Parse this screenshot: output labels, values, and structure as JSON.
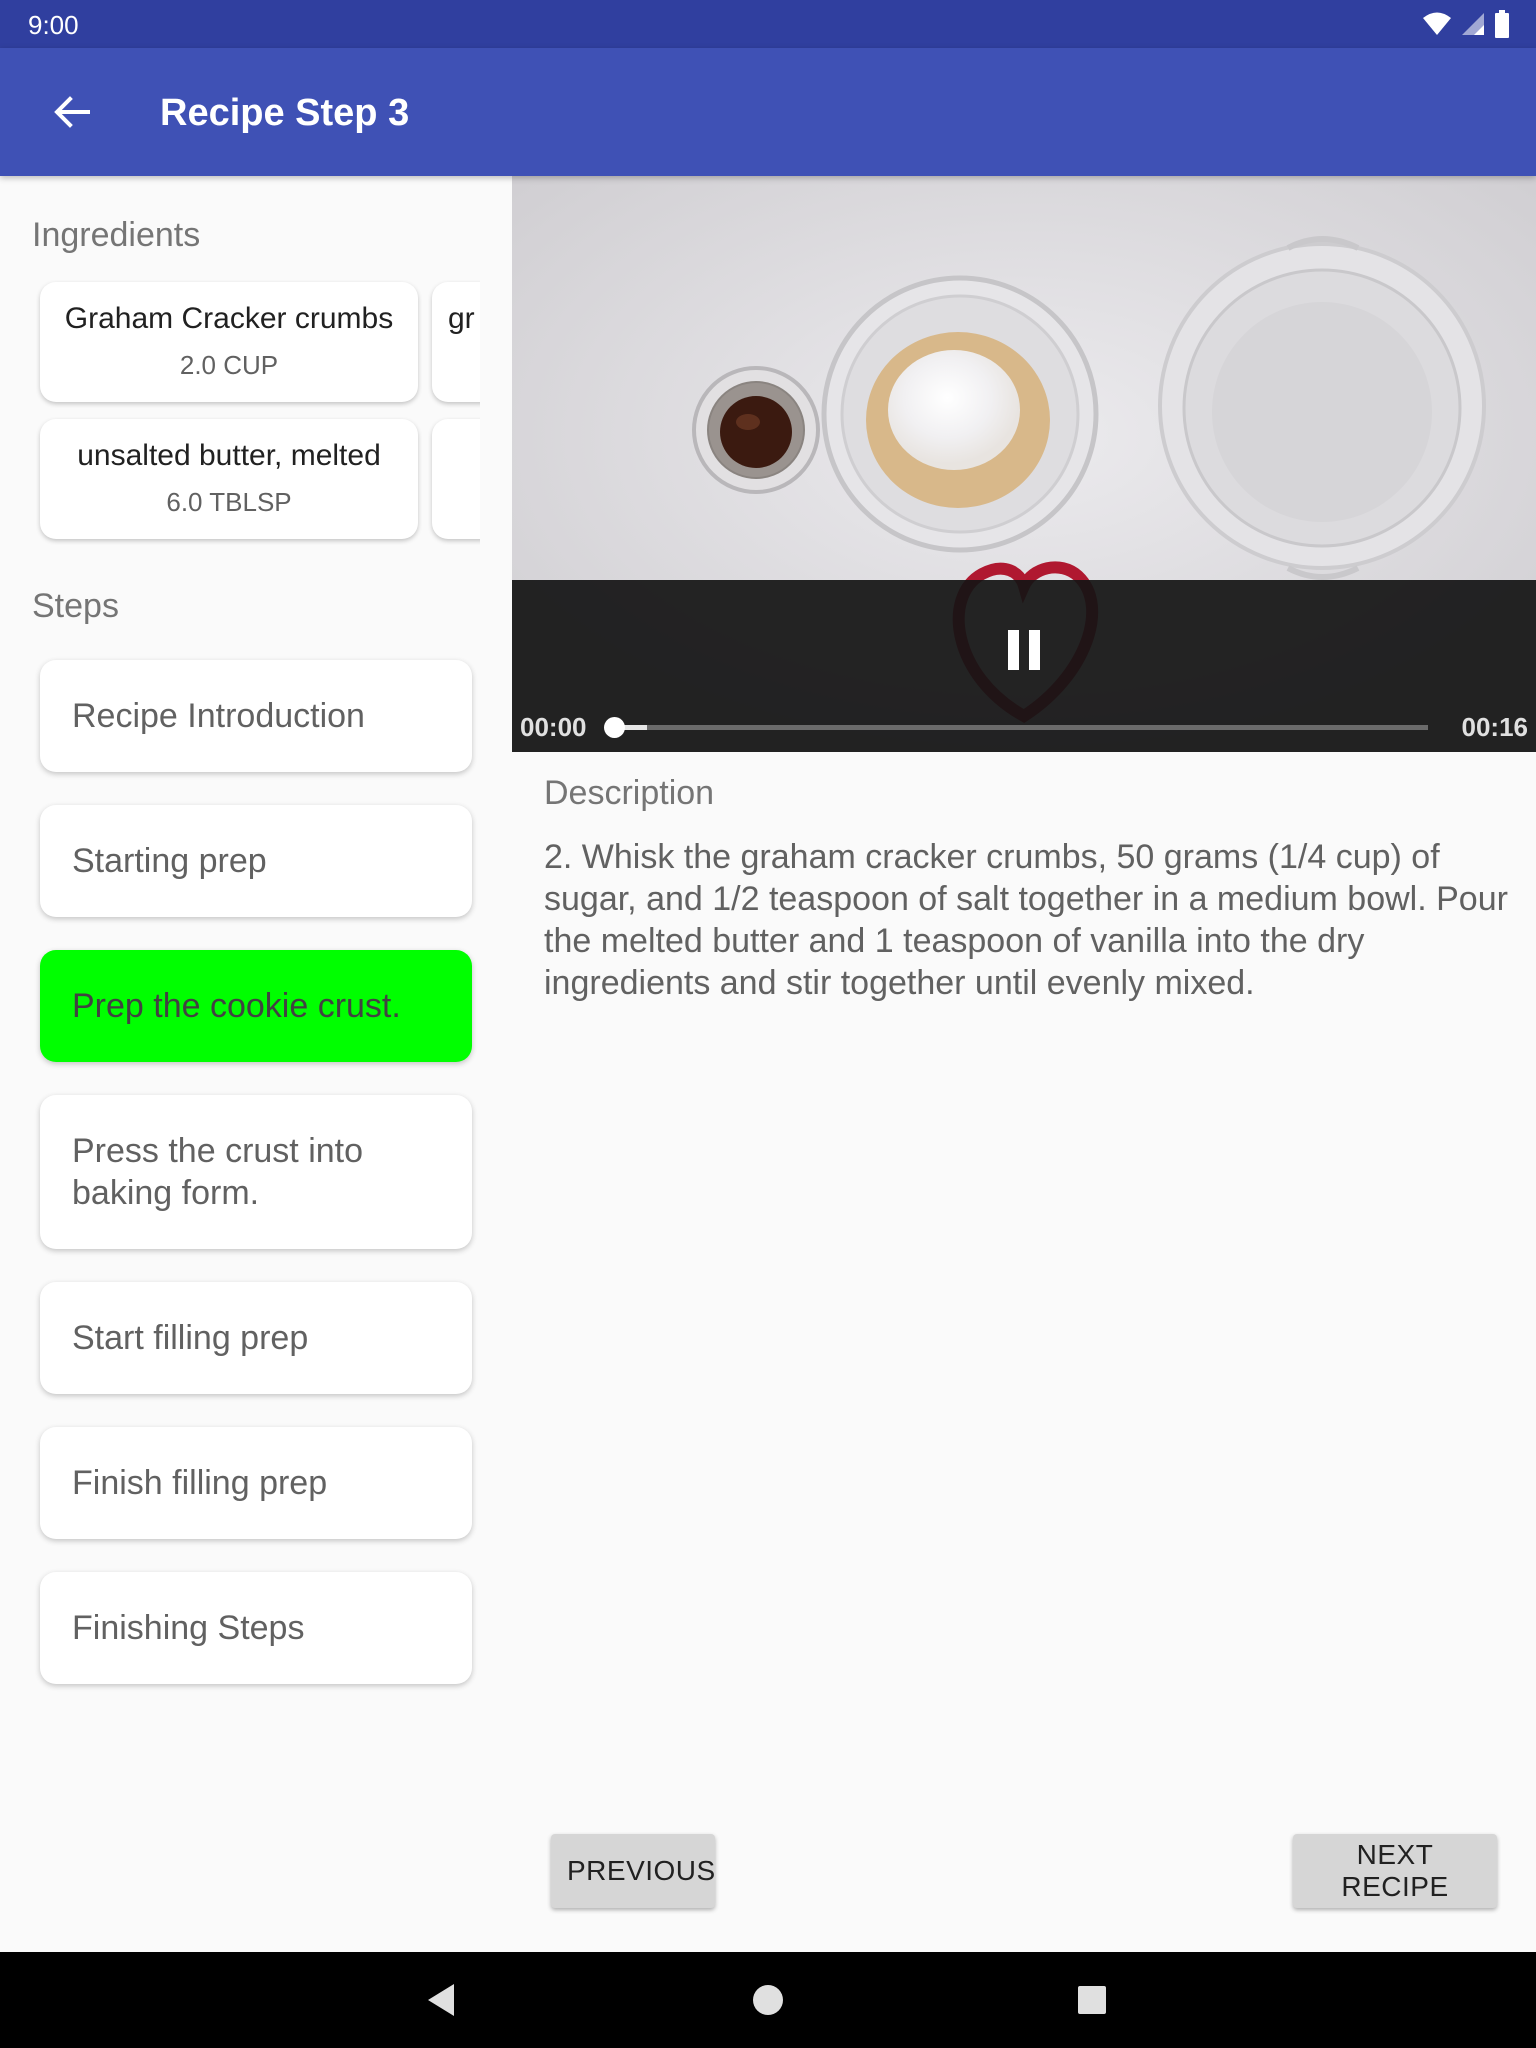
{
  "status_bar": {
    "time": "9:00"
  },
  "app_bar": {
    "title": "Recipe Step 3"
  },
  "ingredients": {
    "label": "Ingredients",
    "items": [
      {
        "name": "Graham Cracker crumbs",
        "quantity": "2.0 CUP"
      },
      {
        "name": "gr",
        "quantity": ""
      },
      {
        "name": "unsalted butter, melted",
        "quantity": "6.0 TBLSP"
      },
      {
        "name": "",
        "quantity": ""
      }
    ]
  },
  "steps": {
    "label": "Steps",
    "items": [
      {
        "label": "Recipe Introduction"
      },
      {
        "label": "Starting prep"
      },
      {
        "label": "Prep the cookie crust."
      },
      {
        "label": "Press the crust into baking form."
      },
      {
        "label": "Start filling prep"
      },
      {
        "label": "Finish filling prep"
      },
      {
        "label": "Finishing Steps"
      }
    ],
    "selected_index": 2
  },
  "player": {
    "current_time": "00:00",
    "total_time": "00:16",
    "progress": 0.0,
    "buffered": 0.04
  },
  "description": {
    "label": "Description",
    "text": "2. Whisk the graham cracker crumbs, 50 grams (1/4 cup) of sugar, and 1/2 teaspoon of salt together in a medium bowl. Pour the melted butter and 1 teaspoon of vanilla into the dry ingredients and stir together until evenly mixed."
  },
  "buttons": {
    "previous": "PREVIOUS",
    "next": "NEXT RECIPE"
  },
  "colors": {
    "primary_dark": "#303f9f",
    "primary": "#3f51b5",
    "selected_step": "#00ff00"
  }
}
